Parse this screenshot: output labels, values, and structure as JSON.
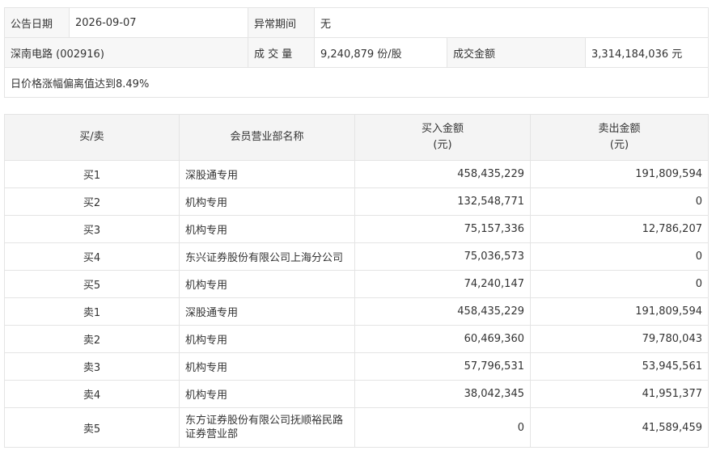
{
  "info": {
    "announce_label": "公告日期",
    "announce_date": "2026-09-07",
    "period_label": "异常期间",
    "period_value": "无",
    "stock": "深南电路 (002916)",
    "volume_label": "成 交 量",
    "volume_value": "9,240,879 份/股",
    "amount_label": "成交金额",
    "amount_value": "3,314,184,036 元",
    "reason": "日价格涨幅偏离值达到8.49%"
  },
  "table": {
    "headers": {
      "side": "买/卖",
      "branch": "会员营业部名称",
      "buy_line1": "买入金额",
      "buy_line2": "(元)",
      "sell_line1": "卖出金额",
      "sell_line2": "(元)"
    },
    "rows": [
      {
        "side": "买1",
        "branch": "深股通专用",
        "buy": "458,435,229",
        "sell": "191,809,594"
      },
      {
        "side": "买2",
        "branch": "机构专用",
        "buy": "132,548,771",
        "sell": "0"
      },
      {
        "side": "买3",
        "branch": "机构专用",
        "buy": "75,157,336",
        "sell": "12,786,207"
      },
      {
        "side": "买4",
        "branch": "东兴证券股份有限公司上海分公司",
        "buy": "75,036,573",
        "sell": "0"
      },
      {
        "side": "买5",
        "branch": "机构专用",
        "buy": "74,240,147",
        "sell": "0"
      },
      {
        "side": "卖1",
        "branch": "深股通专用",
        "buy": "458,435,229",
        "sell": "191,809,594"
      },
      {
        "side": "卖2",
        "branch": "机构专用",
        "buy": "60,469,360",
        "sell": "79,780,043"
      },
      {
        "side": "卖3",
        "branch": "机构专用",
        "buy": "57,796,531",
        "sell": "53,945,561"
      },
      {
        "side": "卖4",
        "branch": "机构专用",
        "buy": "38,042,345",
        "sell": "41,951,377"
      },
      {
        "side": "卖5",
        "branch": "东方证券股份有限公司抚顺裕民路证券营业部",
        "buy": "0",
        "sell": "41,589,459"
      }
    ]
  }
}
